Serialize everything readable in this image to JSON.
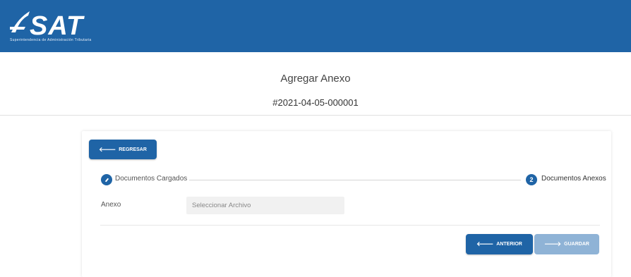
{
  "header": {
    "logo_text": "SAT",
    "logo_subtitle": "Superintendencia de Administración Tributaria",
    "background": "#1f64a6"
  },
  "page": {
    "title": "Agregar Anexo",
    "record_id": "#2021-04-05-000001"
  },
  "toolbar": {
    "back_label": "REGRESAR",
    "back_icon": "arrow-left-icon"
  },
  "stepper": {
    "steps": [
      {
        "label": "Documentos Cargados",
        "icon": "check-icon",
        "state": "completed"
      },
      {
        "label": "Documentos Anexos",
        "number": "2",
        "state": "active"
      }
    ]
  },
  "form": {
    "anexo_label": "Anexo",
    "file_placeholder": "Seleccionar Archivo"
  },
  "actions": {
    "previous_label": "ANTERIOR",
    "save_label": "GUARDAR",
    "save_disabled": true,
    "accent": "#1f64a6",
    "disabled_color": "#8fb3d6"
  }
}
